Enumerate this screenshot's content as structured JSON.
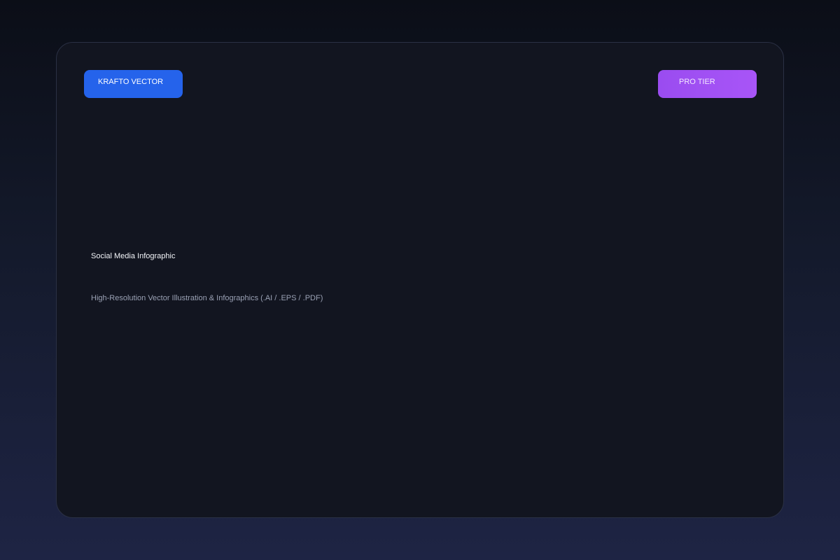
{
  "brand_badge": {
    "label": "KRAFTO VECTOR"
  },
  "tier_badge": {
    "label": "PRO TIER"
  },
  "content": {
    "title": "Social Media Infographic",
    "subtitle": "High-Resolution Vector Illustration & Infographics (.AI / .EPS / .PDF)"
  },
  "colors": {
    "brand_badge": "#2563eb",
    "tier_badge": "#a855f7",
    "card_background": "#121520"
  }
}
